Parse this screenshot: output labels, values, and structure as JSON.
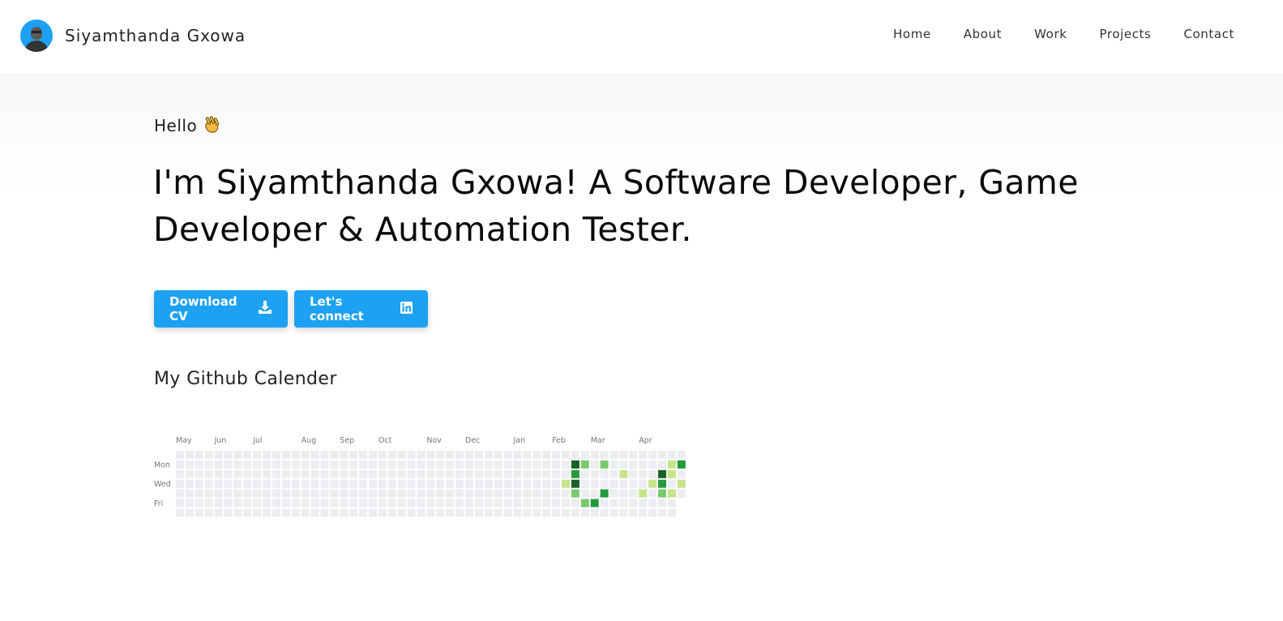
{
  "brand": {
    "name": "Siyamthanda Gxowa",
    "avatar_icon": "profile-avatar"
  },
  "nav": {
    "items": [
      "Home",
      "About",
      "Work",
      "Projects",
      "Contact"
    ]
  },
  "hero": {
    "greeting": "Hello",
    "greeting_icon": "waving-hand-icon",
    "headline_line1": "I'm Siyamthanda Gxowa! A Software Developer, Game",
    "headline_line2": "Developer & Automation Tester.",
    "cta_download": "Download CV",
    "cta_download_icon": "download-icon",
    "cta_connect": "Let's connect",
    "cta_connect_icon": "linkedin-icon"
  },
  "calendar": {
    "title": "My Github Calender",
    "months": [
      {
        "label": "May",
        "week": 0
      },
      {
        "label": "Jun",
        "week": 4
      },
      {
        "label": "Jul",
        "week": 8
      },
      {
        "label": "Aug",
        "week": 13
      },
      {
        "label": "Sep",
        "week": 17
      },
      {
        "label": "Oct",
        "week": 21
      },
      {
        "label": "Nov",
        "week": 26
      },
      {
        "label": "Dec",
        "week": 30
      },
      {
        "label": "Jan",
        "week": 35
      },
      {
        "label": "Feb",
        "week": 39
      },
      {
        "label": "Mar",
        "week": 43
      },
      {
        "label": "Apr",
        "week": 48
      }
    ],
    "day_labels": [
      {
        "label": "Mon",
        "row": 1
      },
      {
        "label": "Wed",
        "row": 3
      },
      {
        "label": "Fri",
        "row": 5
      }
    ],
    "weeks": 53,
    "last_week_days": 5,
    "colors": [
      "#ebedf0",
      "#c6e48b",
      "#7bc96f",
      "#239a3b",
      "#196127"
    ],
    "contributions": [
      {
        "week": 40,
        "day": 3,
        "level": 1
      },
      {
        "week": 41,
        "day": 1,
        "level": 4
      },
      {
        "week": 41,
        "day": 2,
        "level": 3
      },
      {
        "week": 41,
        "day": 3,
        "level": 4
      },
      {
        "week": 41,
        "day": 4,
        "level": 2
      },
      {
        "week": 42,
        "day": 1,
        "level": 2
      },
      {
        "week": 42,
        "day": 5,
        "level": 2
      },
      {
        "week": 43,
        "day": 5,
        "level": 3
      },
      {
        "week": 44,
        "day": 1,
        "level": 2
      },
      {
        "week": 44,
        "day": 4,
        "level": 3
      },
      {
        "week": 46,
        "day": 2,
        "level": 1
      },
      {
        "week": 48,
        "day": 4,
        "level": 1
      },
      {
        "week": 49,
        "day": 3,
        "level": 1
      },
      {
        "week": 50,
        "day": 2,
        "level": 4
      },
      {
        "week": 50,
        "day": 3,
        "level": 3
      },
      {
        "week": 50,
        "day": 4,
        "level": 2
      },
      {
        "week": 51,
        "day": 1,
        "level": 1
      },
      {
        "week": 51,
        "day": 2,
        "level": 1
      },
      {
        "week": 51,
        "day": 4,
        "level": 1
      },
      {
        "week": 52,
        "day": 1,
        "level": 3
      },
      {
        "week": 52,
        "day": 3,
        "level": 1
      }
    ]
  }
}
